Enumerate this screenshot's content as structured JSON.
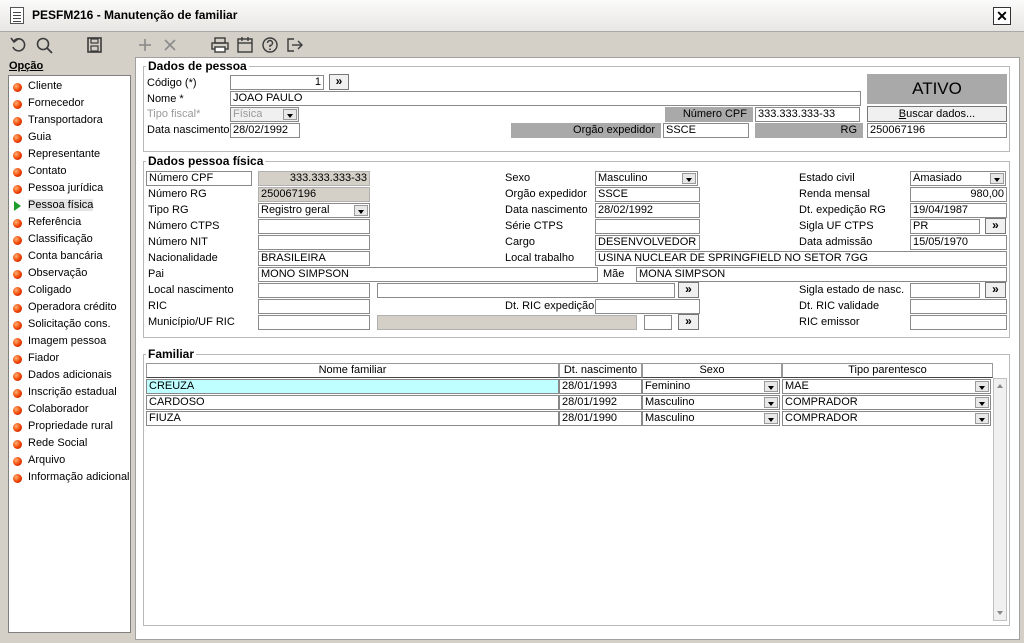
{
  "window": {
    "title": "PESFM216 - Manutenção de familiar",
    "close_label": "✕"
  },
  "sidebar": {
    "title": "Opção",
    "items": [
      {
        "label": "Cliente"
      },
      {
        "label": "Fornecedor"
      },
      {
        "label": "Transportadora"
      },
      {
        "label": "Guia"
      },
      {
        "label": "Representante"
      },
      {
        "label": "Contato"
      },
      {
        "label": "Pessoa jurídica"
      },
      {
        "label": "Pessoa física"
      },
      {
        "label": "Referência"
      },
      {
        "label": "Classificação"
      },
      {
        "label": "Conta bancária"
      },
      {
        "label": "Observação"
      },
      {
        "label": "Coligado"
      },
      {
        "label": "Operadora crédito"
      },
      {
        "label": "Solicitação cons."
      },
      {
        "label": "Imagem pessoa"
      },
      {
        "label": "Fiador"
      },
      {
        "label": "Dados adicionais"
      },
      {
        "label": "Inscrição estadual"
      },
      {
        "label": "Colaborador"
      },
      {
        "label": "Propriedade rural"
      },
      {
        "label": "Rede Social"
      },
      {
        "label": "Arquivo"
      },
      {
        "label": "Informação adicional"
      }
    ]
  },
  "dados_pessoa": {
    "title": "Dados de pessoa",
    "codigo_label": "Código (*)",
    "codigo": "1",
    "nome_label": "Nome *",
    "nome": "JOAO PAULO",
    "tipo_fiscal_label": "Tipo fiscal*",
    "tipo_fiscal": "Física",
    "data_nasc_label": "Data nascimento",
    "data_nasc": "28/02/1992",
    "cpf_label": "Número CPF",
    "cpf": "333.333.333-33",
    "orgao_label": "Orgão expedidor",
    "orgao": "SSCE",
    "rg_label": "RG",
    "rg": "250067196",
    "status": "ATIVO",
    "buscar_label": "Buscar dados...",
    "buscar_key": "B",
    "buscar_rest": "uscar dados...",
    "more_glyph": "»"
  },
  "pf": {
    "title": "Dados pessoa física",
    "cpf_label": "Número CPF",
    "cpf": "333.333.333-33",
    "rg_label": "Número RG",
    "rg": "250067196",
    "tipo_rg_label": "Tipo RG",
    "tipo_rg": "Registro geral",
    "ctps_label": "Número CTPS",
    "nit_label": "Número NIT",
    "nacionalidade_label": "Nacionalidade",
    "nacionalidade": "BRASILEIRA",
    "pai_label": "Pai",
    "pai": "MONO SIMPSON",
    "mae_label": "Mãe",
    "mae": "MONA SIMPSON",
    "local_nasc_label": "Local nascimento",
    "ric_label": "RIC",
    "municipio_label": "Município/UF RIC",
    "sexo_label": "Sexo",
    "sexo": "Masculino",
    "orgao_label": "Orgão expedidor",
    "orgao": "SSCE",
    "data_nasc_label": "Data nascimento",
    "data_nasc": "28/02/1992",
    "serie_ctps_label": "Série CTPS",
    "cargo_label": "Cargo",
    "cargo": "DESENVOLVEDOR",
    "local_trabalho_label": "Local trabalho",
    "local_trabalho": "USINA NUCLEAR DE SPRINGFIELD NO SETOR 7GG",
    "dt_ric_exp_label": "Dt. RIC expedição",
    "estado_civil_label": "Estado civil",
    "estado_civil": "Amasiado",
    "renda_label": "Renda mensal",
    "renda": "980,00",
    "dt_exp_rg_label": "Dt. expedição RG",
    "dt_exp_rg": "19/04/1987",
    "uf_ctps_label": "Sigla UF CTPS",
    "uf_ctps": "PR",
    "dt_admissao_label": "Data admissão",
    "dt_admissao": "15/05/1970",
    "sigla_nasc_label": "Sigla estado de nasc.",
    "dt_ric_val_label": "Dt. RIC validade",
    "ric_emissor_label": "RIC emissor"
  },
  "familiar": {
    "title": "Familiar",
    "columns": [
      "Nome familiar",
      "Dt. nascimento",
      "Sexo",
      "Tipo parentesco"
    ],
    "rows": [
      {
        "nome": "CREUZA",
        "dt": "28/01/1993",
        "sexo": "Feminino",
        "tipo": "MAE"
      },
      {
        "nome": "CARDOSO",
        "dt": "28/01/1992",
        "sexo": "Masculino",
        "tipo": "COMPRADOR"
      },
      {
        "nome": "FIUZA",
        "dt": "28/01/1990",
        "sexo": "Masculino",
        "tipo": "COMPRADOR"
      }
    ]
  },
  "colors": {
    "window_bg": "#d4d0c8",
    "selected_row": "#bfffff",
    "status_bg": "#a9a9a9",
    "active_arrow": "#1f9d2a"
  }
}
